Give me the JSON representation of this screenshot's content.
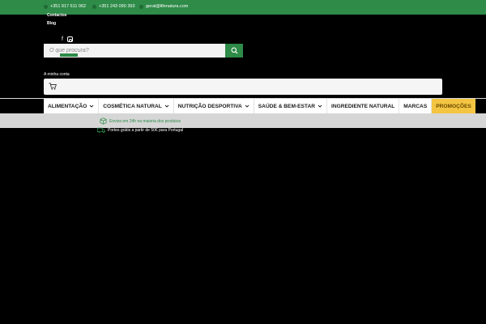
{
  "topbar": {
    "phone1": "+351 917 611 062",
    "phone2": "+351 243 090 393",
    "email": "geral@lifenatura.com"
  },
  "links": {
    "contacts": "Contactos",
    "blog": "Blog"
  },
  "search": {
    "placeholder": "O que procura?"
  },
  "account": {
    "label": "A minha conta"
  },
  "nav": {
    "items": [
      {
        "label": "ALIMENTAÇÃO",
        "dropdown": true
      },
      {
        "label": "COSMÉTICA NATURAL",
        "dropdown": true
      },
      {
        "label": "NUTRIÇÃO DESPORTIVA",
        "dropdown": true
      },
      {
        "label": "SAÚDE & BEM-ESTAR",
        "dropdown": true
      },
      {
        "label": "INGREDIENTE NATURAL",
        "dropdown": false
      },
      {
        "label": "MARCAS",
        "dropdown": false
      },
      {
        "label": "PROMOÇÕES",
        "dropdown": false
      }
    ]
  },
  "benefits": {
    "shipping": "Envios em 24h na maioria dos produtos",
    "free_shipping": "Portes grátis a partir de 50€ para Portugal"
  },
  "colors": {
    "brand_green": "#2e8b48",
    "promo_yellow": "#f4c542"
  }
}
